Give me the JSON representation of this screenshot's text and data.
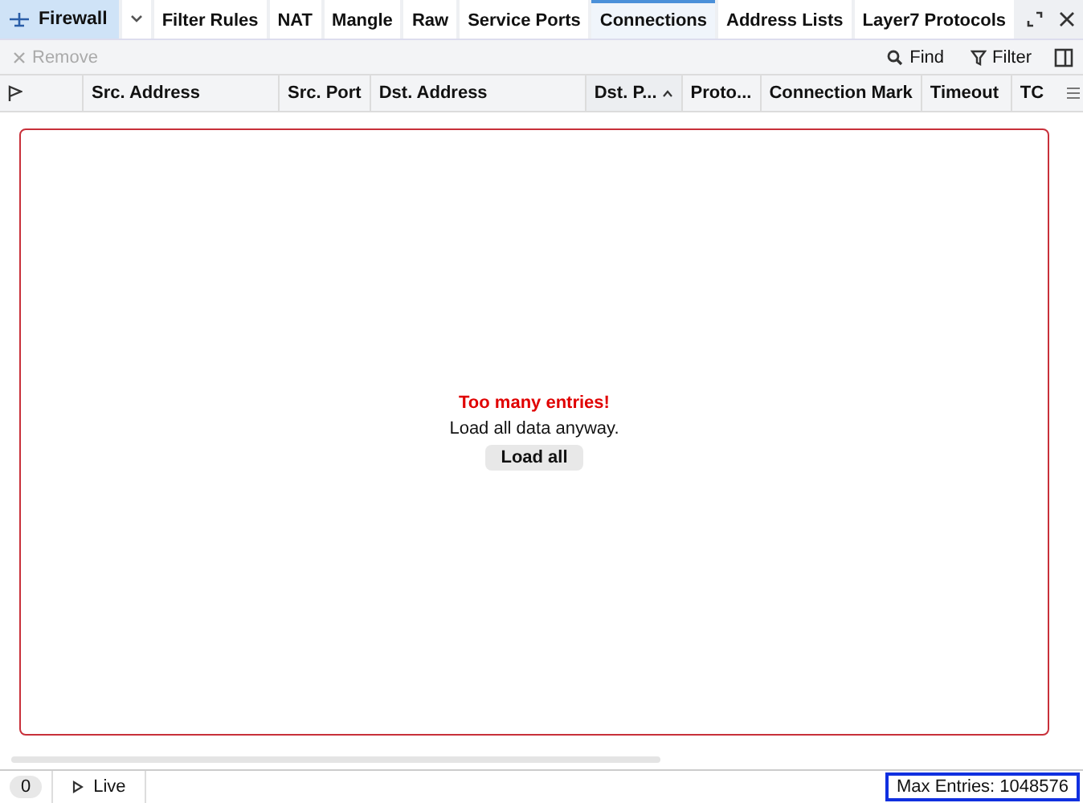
{
  "app_tab": {
    "label": "Firewall"
  },
  "tabs": [
    {
      "label": "Filter Rules",
      "selected": false
    },
    {
      "label": "NAT",
      "selected": false
    },
    {
      "label": "Mangle",
      "selected": false
    },
    {
      "label": "Raw",
      "selected": false
    },
    {
      "label": "Service Ports",
      "selected": false
    },
    {
      "label": "Connections",
      "selected": true
    },
    {
      "label": "Address Lists",
      "selected": false
    },
    {
      "label": "Layer7 Protocols",
      "selected": false
    }
  ],
  "toolbar": {
    "remove": {
      "label": "Remove",
      "disabled": true
    },
    "find": "Find",
    "filter": "Filter"
  },
  "table": {
    "columns": [
      {
        "label": "Src. Address",
        "sorted": false
      },
      {
        "label": "Src. Port",
        "sorted": false
      },
      {
        "label": "Dst. Address",
        "sorted": false
      },
      {
        "label": "Dst. P...",
        "sorted": true
      },
      {
        "label": "Proto...",
        "sorted": false
      },
      {
        "label": "Connection Mark",
        "sorted": false
      },
      {
        "label": "Timeout",
        "sorted": false
      },
      {
        "label": "TC",
        "sorted": false
      }
    ]
  },
  "notice": {
    "title": "Too many entries!",
    "message": "Load all data anyway.",
    "button": "Load all"
  },
  "status_bar": {
    "count": "0",
    "live": "Live",
    "max_entries": "Max Entries: 1048576",
    "max_entries_focused": true
  }
}
